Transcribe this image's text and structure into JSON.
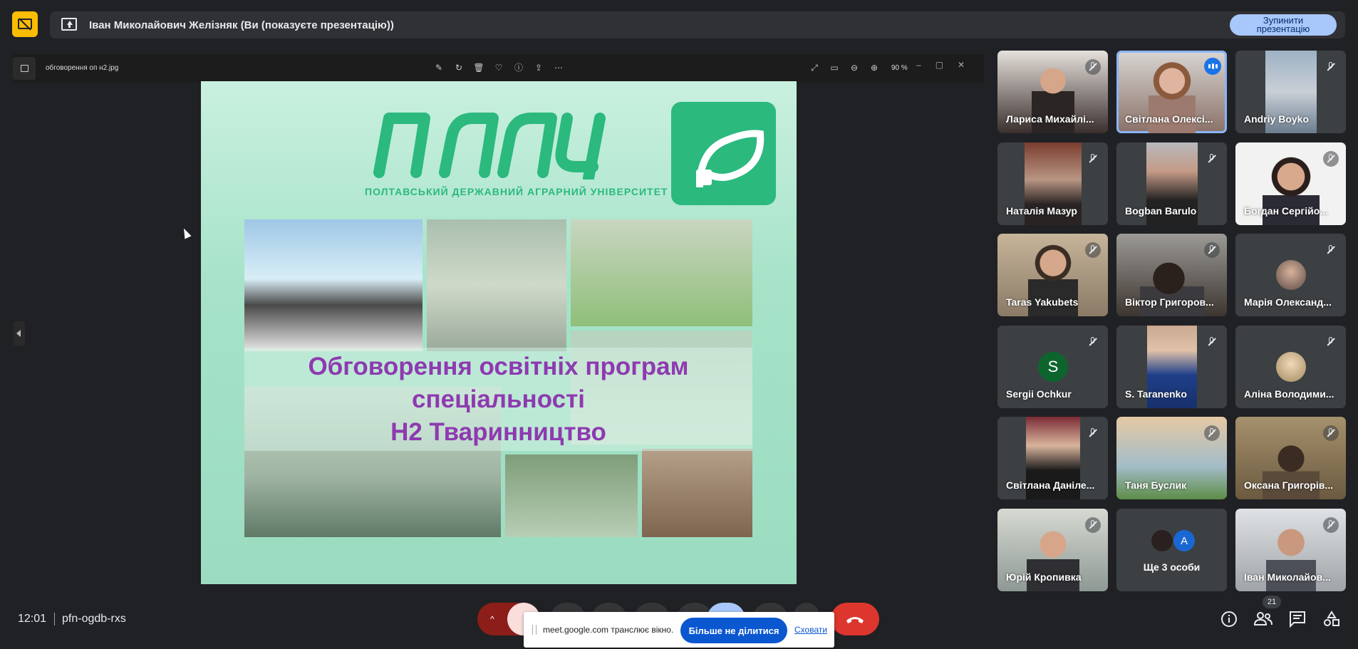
{
  "header": {
    "presenter_text": "Іван Миколайович Желізняк (Ви (показуєте презентацію))",
    "stop_presenting_line1": "Зупинити",
    "stop_presenting_line2": "презентацію"
  },
  "viewer": {
    "file_name": "обговорення оп н2.jpg",
    "zoom": "90 %",
    "tools": [
      "edit-icon",
      "rotate-icon",
      "delete-icon",
      "favorite-icon",
      "info-icon",
      "share-icon",
      "more-icon"
    ]
  },
  "slide": {
    "logo": "ПДАУ",
    "university": "ПОЛТАВСЬКИЙ ДЕРЖАВНИЙ АГРАРНИЙ УНІВЕРСИТЕТ",
    "title_line1": "Обговорення освітніх програм",
    "title_line2": "спеціальності",
    "title_line3": "Н2 Тваринництво",
    "brand_color": "#2bb97e",
    "title_color": "#8e3ab0"
  },
  "participants": [
    {
      "name": "Лариса Михайлі...",
      "muted": true
    },
    {
      "name": "Світлана Олексі...",
      "muted": false,
      "speaking": true
    },
    {
      "name": "Andriy Boyko",
      "muted": true
    },
    {
      "name": "Наталія Мазур",
      "muted": true
    },
    {
      "name": "Bogban Barulo",
      "muted": true
    },
    {
      "name": "Богдан Сергійо...",
      "muted": true
    },
    {
      "name": "Taras Yakubets",
      "muted": true
    },
    {
      "name": "Віктор Григоров...",
      "muted": true
    },
    {
      "name": "Марія Олександ...",
      "muted": true
    },
    {
      "name": "Sergii Ochkur",
      "muted": true,
      "initial": "S",
      "avatar_color": "#0d652d"
    },
    {
      "name": "S. Taranenko",
      "muted": true
    },
    {
      "name": "Аліна Володими...",
      "muted": true
    },
    {
      "name": "Світлана Даніле...",
      "muted": true
    },
    {
      "name": "Таня Буслик",
      "muted": true
    },
    {
      "name": "Оксана Григорів...",
      "muted": true
    },
    {
      "name": "Юрій Кропивка",
      "muted": true
    },
    {
      "name": "Ще 3 особи",
      "more": true,
      "initial": "A"
    },
    {
      "name": "Іван Миколайов...",
      "muted": true
    }
  ],
  "bottom": {
    "time": "12:01",
    "meeting_code": "pfn-ogdb-rxs",
    "people_count": "21"
  },
  "share_bubble": {
    "text": "meet.google.com транслює вікно.",
    "stop_label": "Більше не ділитися",
    "hide_label": "Сховати"
  }
}
